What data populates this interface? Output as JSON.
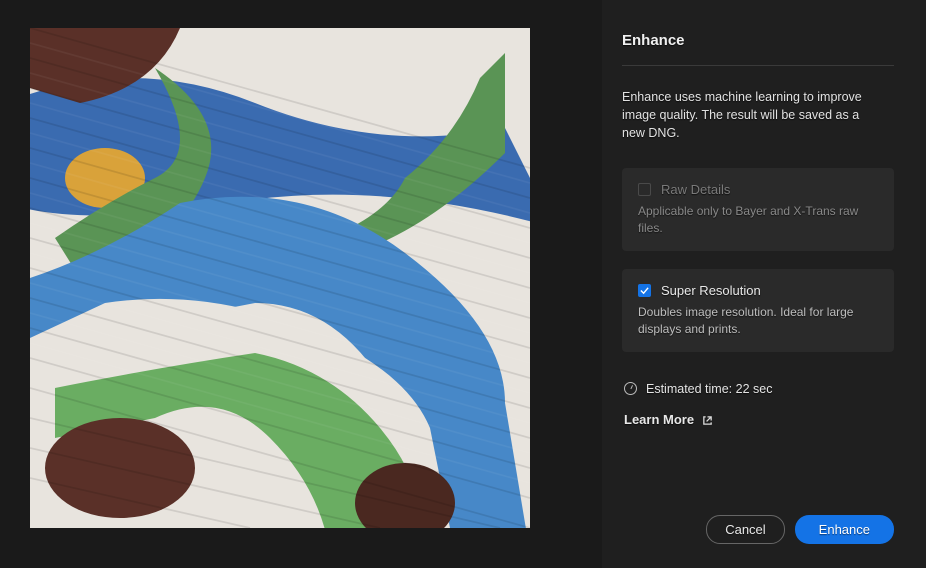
{
  "dialog": {
    "title": "Enhance",
    "description": "Enhance uses machine learning to improve image quality. The result will be saved as a new DNG."
  },
  "options": {
    "raw_details": {
      "label": "Raw Details",
      "description": "Applicable only to Bayer and X-Trans raw files.",
      "checked": false,
      "enabled": false
    },
    "super_resolution": {
      "label": "Super Resolution",
      "description": "Doubles image resolution. Ideal for large displays and prints.",
      "checked": true,
      "enabled": true
    }
  },
  "estimated_time": "Estimated time: 22 sec",
  "learn_more": "Learn More",
  "actions": {
    "cancel": "Cancel",
    "enhance": "Enhance"
  }
}
